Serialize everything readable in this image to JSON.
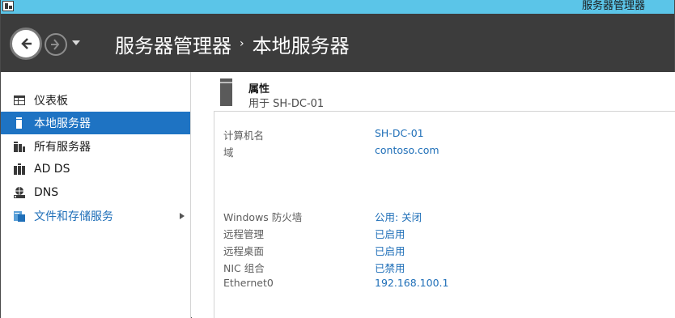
{
  "window": {
    "title": "服务器管理器"
  },
  "header": {
    "breadcrumb": [
      "服务器管理器",
      "本地服务器"
    ],
    "breadcrumb_separator": "›"
  },
  "sidebar": {
    "items": [
      {
        "label": "仪表板",
        "icon": "dashboard-icon",
        "state": "normal"
      },
      {
        "label": "本地服务器",
        "icon": "local-server-icon",
        "state": "selected"
      },
      {
        "label": "所有服务器",
        "icon": "all-servers-icon",
        "state": "normal"
      },
      {
        "label": "AD DS",
        "icon": "ad-ds-icon",
        "state": "normal"
      },
      {
        "label": "DNS",
        "icon": "dns-icon",
        "state": "normal"
      },
      {
        "label": "文件和存储服务",
        "icon": "file-storage-icon",
        "state": "link",
        "has_submenu": true
      }
    ]
  },
  "properties": {
    "title": "属性",
    "subtitle": "用于 SH-DC-01",
    "rows": [
      {
        "label": "计算机名",
        "value": "SH-DC-01"
      },
      {
        "label": "域",
        "value": "contoso.com"
      },
      {
        "label": "Windows 防火墙",
        "value": "公用: 关闭"
      },
      {
        "label": "远程管理",
        "value": "已启用"
      },
      {
        "label": "远程桌面",
        "value": "已启用"
      },
      {
        "label": "NIC 组合",
        "value": "已禁用"
      },
      {
        "label": "Ethernet0",
        "value": "192.168.100.1"
      }
    ]
  },
  "colors": {
    "titlebar": "#5bc5e8",
    "header": "#3c3c3c",
    "selected": "#1e73c3",
    "link": "#1f6fb8"
  }
}
